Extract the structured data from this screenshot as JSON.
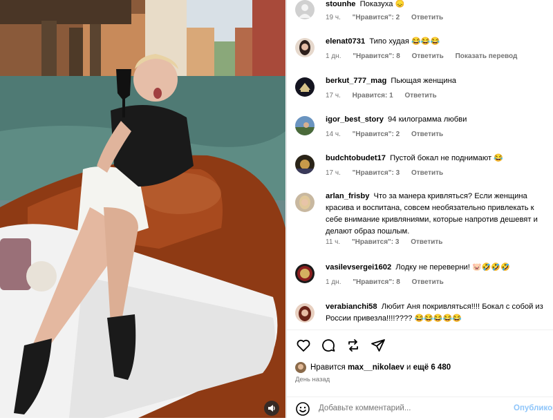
{
  "comments": [
    {
      "username": "stounhe",
      "text": "Показуха",
      "emoji": "😞",
      "time": "19 ч.",
      "likes": "\"Нравится\": 2",
      "reply": "Ответить",
      "translate": "",
      "avatar_color": "#c9c9c9"
    },
    {
      "username": "elenat0731",
      "text": "Типо худая",
      "emoji": "😂😂😂",
      "time": "1 дн.",
      "likes": "\"Нравится\": 8",
      "reply": "Ответить",
      "translate": "Показать перевод",
      "avatar_color": "#3a2c28"
    },
    {
      "username": "berkut_777_mag",
      "text": "Пьющая женщина",
      "emoji": "",
      "time": "17 ч.",
      "likes": "Нравится: 1",
      "reply": "Ответить",
      "translate": "",
      "avatar_color": "#1e1e2a"
    },
    {
      "username": "igor_best_story",
      "text": "94 килограмма любви",
      "emoji": "",
      "time": "14 ч.",
      "likes": "\"Нравится\": 2",
      "reply": "Ответить",
      "translate": "",
      "avatar_color": "#4f7aa8"
    },
    {
      "username": "budchtobudet17",
      "text": "Пустой бокал не поднимают",
      "emoji": "😂",
      "time": "17 ч.",
      "likes": "\"Нравится\": 3",
      "reply": "Ответить",
      "translate": "",
      "avatar_color": "#5a4a2a"
    },
    {
      "username": "arlan_frisby",
      "text": "Что за манера кривляться? Если женщина красива и воспитана, совсем необязательно привлекать к себе внимание кривляниями, которые напротив дешевят и делают образ пошлым.",
      "emoji": "",
      "time": "11 ч.",
      "likes": "\"Нравится\": 3",
      "reply": "Ответить",
      "translate": "",
      "avatar_color": "#b8a48a"
    },
    {
      "username": "vasilevsergei1602",
      "text": "Лодку не переверни!",
      "emoji": "🐷🤣🤣🤣",
      "time": "1 дн.",
      "likes": "\"Нравится\": 8",
      "reply": "Ответить",
      "translate": "",
      "avatar_color": "#6a1a1a"
    },
    {
      "username": "verabianchi58",
      "text": "Любит Аня покривляться!!!! Бокал с собой из России привезла!!!!????",
      "emoji": "😂😂😂😂😂",
      "time": "",
      "likes": "",
      "reply": "",
      "translate": "",
      "avatar_color": "#8a3a2a"
    }
  ],
  "actions": {
    "icons": [
      "heart-icon",
      "comment-icon",
      "share-icon",
      "send-icon"
    ],
    "likes_prefix": "Нравится",
    "likes_user": "max__nikolaev",
    "likes_mid": "и",
    "likes_rest": "ещё 6 480",
    "date": "День назад",
    "comment_placeholder": "Добавьте комментарий...",
    "post_label": "Опубликовать"
  },
  "colors": {
    "link": "#8ec5fa",
    "meta": "#737373",
    "accent": "#0095f6"
  }
}
